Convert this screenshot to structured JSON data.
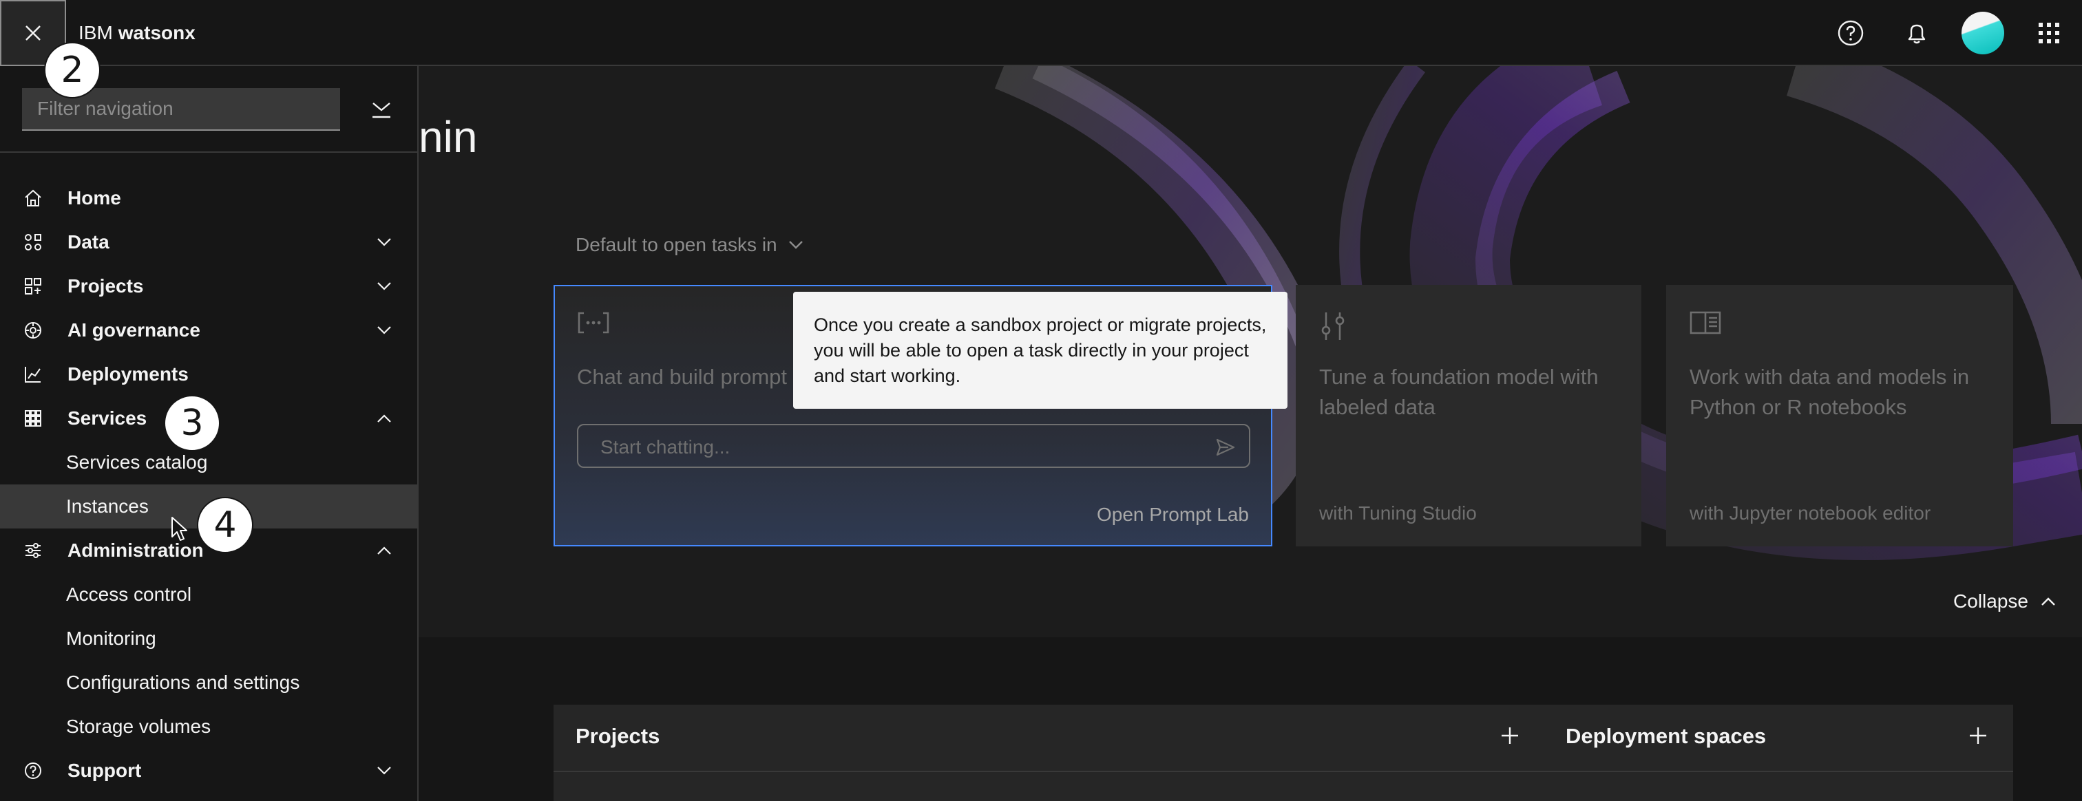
{
  "header": {
    "brand_prefix": "IBM",
    "brand_name": "watsonx"
  },
  "sidebar": {
    "filter_placeholder": "Filter navigation",
    "items": {
      "home": "Home",
      "data": "Data",
      "projects": "Projects",
      "ai_governance": "AI governance",
      "deployments": "Deployments",
      "services": "Services",
      "services_catalog": "Services catalog",
      "instances": "Instances",
      "administration": "Administration",
      "access_control": "Access control",
      "monitoring": "Monitoring",
      "configurations": "Configurations and settings",
      "storage_volumes": "Storage volumes",
      "support": "Support"
    }
  },
  "steps": {
    "s2": "2",
    "s3": "3",
    "s4": "4"
  },
  "main": {
    "welcome_fragment": "nin",
    "task_dropdown": "Default to open tasks in",
    "cards": {
      "prompt": {
        "title": "Chat and build prompt",
        "chat_placeholder": "Start chatting...",
        "link": "Open Prompt Lab"
      },
      "tuning": {
        "title": "Tune a foundation model with labeled data",
        "foot": "with Tuning Studio"
      },
      "notebook": {
        "title": "Work with data and models in Python or R notebooks",
        "foot": "with Jupyter notebook editor"
      }
    },
    "tooltip": "Once you create a sandbox project or migrate projects, you will be able to open a task directly in your project and start working.",
    "collapse": "Collapse",
    "panels": {
      "projects": "Projects",
      "deployment_spaces": "Deployment spaces"
    }
  },
  "colors": {
    "accent": "#4589ff",
    "background": "#161616",
    "surface": "#262626"
  }
}
